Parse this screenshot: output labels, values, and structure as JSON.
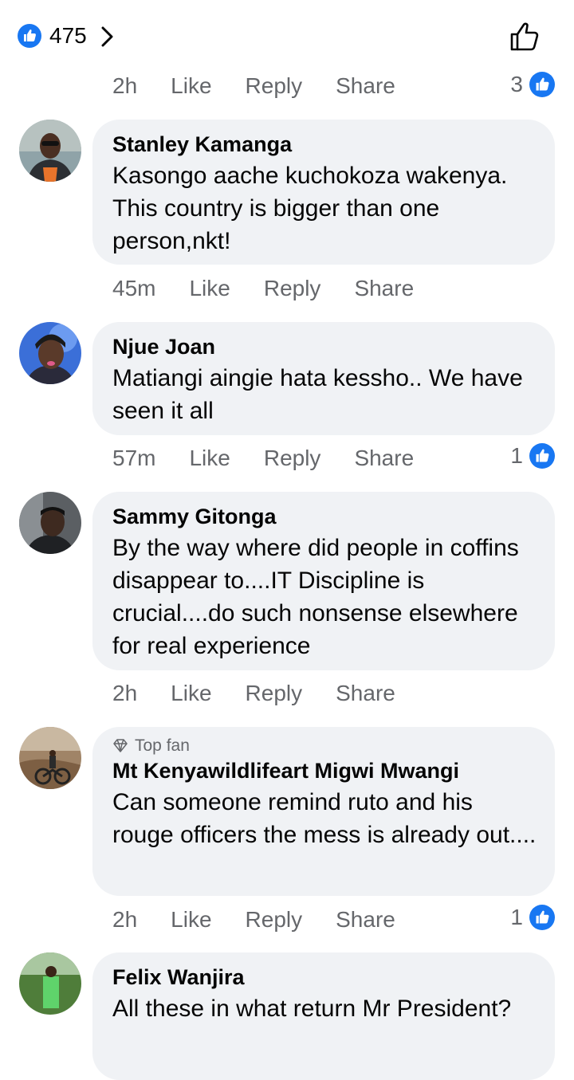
{
  "header": {
    "reaction_count": "475",
    "reaction_icon": "like-icon",
    "chevron_icon": "chevron-right-icon",
    "like_button_icon": "thumbs-up-outline-icon"
  },
  "first_actions": {
    "time": "2h",
    "like": "Like",
    "reply": "Reply",
    "share": "Share",
    "reactions": "3"
  },
  "comments": [
    {
      "author": "Stanley Kamanga",
      "badge": "",
      "text": "Kasongo aache kuchokoza wakenya. This country is bigger than one person,nkt!",
      "time": "45m",
      "like": "Like",
      "reply": "Reply",
      "share": "Share",
      "reactions": ""
    },
    {
      "author": "Njue Joan",
      "badge": "",
      "text": "Matiangi aingie hata kessho.. We have seen it all",
      "time": "57m",
      "like": "Like",
      "reply": "Reply",
      "share": "Share",
      "reactions": "1"
    },
    {
      "author": "Sammy Gitonga",
      "badge": "",
      "text": "By the way where did people in coffins disappear to....IT Discipline is crucial....do such nonsense elsewhere for real experience",
      "time": "2h",
      "like": "Like",
      "reply": "Reply",
      "share": "Share",
      "reactions": ""
    },
    {
      "author": "Mt Kenyawildlifeart Migwi Mwangi",
      "badge": "Top fan",
      "text": "Can someone remind ruto and his rouge officers the mess is already out....",
      "time": "2h",
      "like": "Like",
      "reply": "Reply",
      "share": "Share",
      "reactions": "1"
    },
    {
      "author": "Felix Wanjira",
      "badge": "",
      "text": "All these in what return Mr President?",
      "time": "",
      "like": "",
      "reply": "",
      "share": "",
      "reactions": ""
    }
  ],
  "colors": {
    "like_blue": "#1877f2",
    "bubble": "#f0f2f5",
    "meta": "#65676b"
  }
}
